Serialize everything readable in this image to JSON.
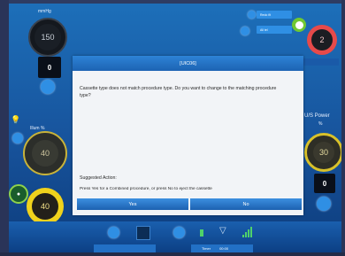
{
  "top_left": {
    "label": "mmHg",
    "value": "150",
    "box": "0"
  },
  "illum": {
    "label": "Illum %",
    "value": "40"
  },
  "bottom_left_knob": {
    "value": "40"
  },
  "top_right": {
    "buttons": [
      "Redo fit",
      "All tel"
    ],
    "knob_value": "2"
  },
  "us_power": {
    "label": "U/S Power",
    "unit": "%",
    "value": "30",
    "box": "0"
  },
  "dialog": {
    "title": "[UIC06]",
    "message": "Cassette type does not match procedure type.  Do you want to change to the matching procedure type?",
    "suggested_label": "Suggested Action:",
    "suggested_action": "Press Yes for a  Combined procedure, or press No to eject the cassette",
    "yes": "Yes",
    "no": "No"
  },
  "bottom_bar": {
    "tab_1": "Timer",
    "tab_2": "00:00"
  },
  "colors": {
    "dialog_header": "#1d63b3",
    "knob_yellow": "#f0d21c",
    "knob_red": "#e64a4a",
    "knob_green": "#6fc832"
  }
}
